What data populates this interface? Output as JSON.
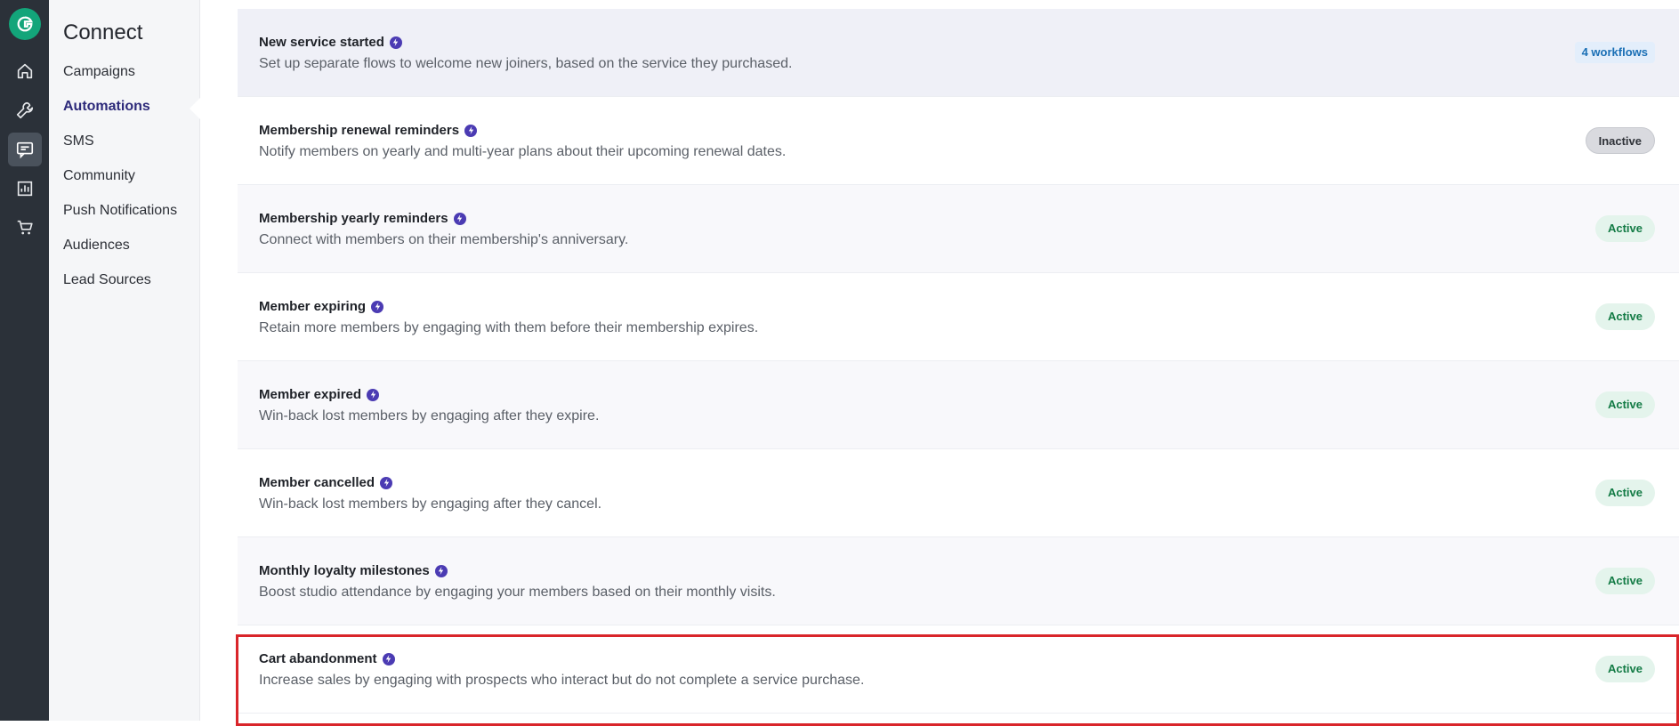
{
  "rail": {
    "items": [
      {
        "icon": "home-icon",
        "active": false
      },
      {
        "icon": "wrench-icon",
        "active": false
      },
      {
        "icon": "chat-icon",
        "active": true
      },
      {
        "icon": "chart-icon",
        "active": false
      },
      {
        "icon": "cart-icon",
        "active": false
      }
    ]
  },
  "subnav": {
    "title": "Connect",
    "items": [
      {
        "label": "Campaigns"
      },
      {
        "label": "Automations"
      },
      {
        "label": "SMS"
      },
      {
        "label": "Community"
      },
      {
        "label": "Push Notifications"
      },
      {
        "label": "Audiences"
      },
      {
        "label": "Lead Sources"
      }
    ],
    "active_index": 1
  },
  "automations": [
    {
      "title": "New service started",
      "description": "Set up separate flows to welcome new joiners, based on the service they purchased.",
      "status": "4 workflows",
      "status_type": "workflows"
    },
    {
      "title": "Membership renewal reminders",
      "description": "Notify members on yearly and multi-year plans about their upcoming renewal dates.",
      "status": "Inactive",
      "status_type": "inactive"
    },
    {
      "title": "Membership yearly reminders",
      "description": "Connect with members on their membership's anniversary.",
      "status": "Active",
      "status_type": "active"
    },
    {
      "title": "Member expiring",
      "description": "Retain more members by engaging with them before their membership expires.",
      "status": "Active",
      "status_type": "active"
    },
    {
      "title": "Member expired",
      "description": "Win-back lost members by engaging after they expire.",
      "status": "Active",
      "status_type": "active"
    },
    {
      "title": "Member cancelled",
      "description": "Win-back lost members by engaging after they cancel.",
      "status": "Active",
      "status_type": "active"
    },
    {
      "title": "Monthly loyalty milestones",
      "description": "Boost studio attendance by engaging your members based on their monthly visits.",
      "status": "Active",
      "status_type": "active"
    },
    {
      "title": "Cart abandonment",
      "description": "Increase sales by engaging with prospects who interact but do not complete a service purchase.",
      "status": "Active",
      "status_type": "active"
    }
  ],
  "colors": {
    "rail_bg": "#2b3139",
    "brand": "#13a57a",
    "accent": "#4b3bb3",
    "active_badge": "#137b45",
    "highlight_border": "#d9252a"
  }
}
